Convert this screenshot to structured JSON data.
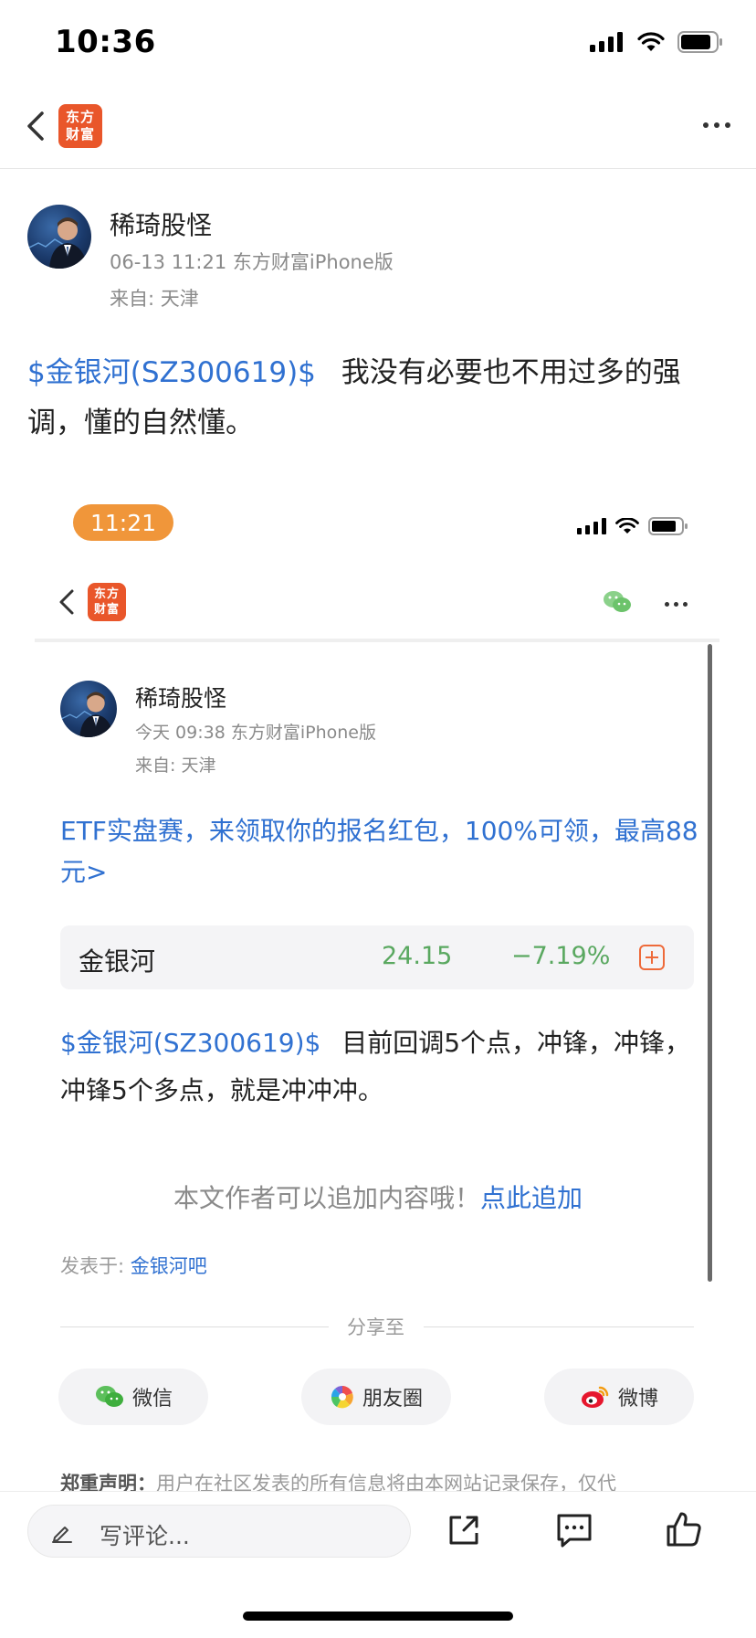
{
  "status_bar": {
    "time": "10:36"
  },
  "nav": {
    "logo_line1": "东方",
    "logo_line2": "财富"
  },
  "post": {
    "author": "稀琦股怪",
    "timestamp": "06-13 11:21 东方财富iPhone版",
    "location": "来自: 天津",
    "stock_link": "$金银河(SZ300619)$",
    "text": "我没有必要也不用过多的强调，懂的自然懂。"
  },
  "embedded": {
    "time_pill": "11:21",
    "nav": {
      "logo_line1": "东方",
      "logo_line2": "财富"
    },
    "post": {
      "author": "稀琦股怪",
      "timestamp": "今天 09:38 东方财富iPhone版",
      "location": "来自: 天津",
      "promo": "ETF实盘赛，来领取你的报名红包，100%可领，最高88元>",
      "quote": {
        "name": "金银河",
        "price": "24.15",
        "change": "−7.19%"
      },
      "stock_link": "$金银河(SZ300619)$",
      "text": "目前回调5个点，冲锋，冲锋，冲锋5个多点，就是冲冲冲。",
      "append_text": "本文作者可以追加内容哦！",
      "append_link": "点此追加",
      "posted_in_label": "发表于:",
      "posted_in_link": "金银河吧",
      "share_label": "分享至",
      "share_buttons": [
        "微信",
        "朋友圈",
        "微博"
      ],
      "disclaimer_title": "郑重声明：",
      "disclaimer_text": "用户在社区发表的所有信息将由本网站记录保存，仅代"
    }
  },
  "bottom_bar": {
    "comment_placeholder": "写评论..."
  },
  "colors": {
    "link": "#3071d1",
    "logo": "#e9562a",
    "down": "#5aa860",
    "pill": "#f0963a"
  }
}
